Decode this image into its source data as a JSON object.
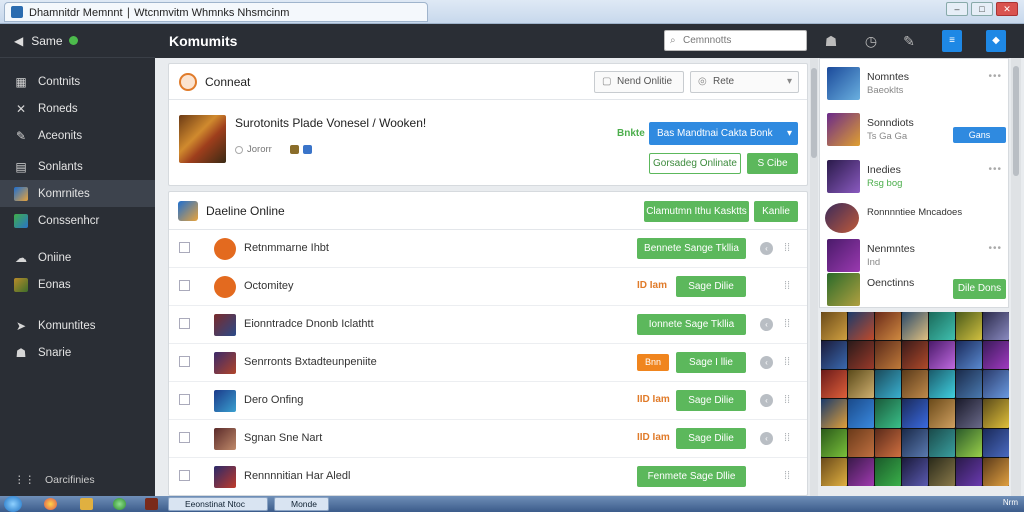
{
  "window": {
    "tab_title": "Dhamnitdr Memnnt ∣ Wtcnmvitm Whmnks Nhsmcinm",
    "minimize": "–",
    "maximize": "□",
    "close": "✕"
  },
  "sidebar": {
    "top_label": "Same",
    "items": [
      {
        "label": "Contnits",
        "icon": "chart-icon"
      },
      {
        "label": "Roneds",
        "icon": "tools-icon"
      },
      {
        "label": "Aceonits",
        "icon": "pen-icon"
      },
      {
        "label": "Sonlants",
        "icon": "book-icon"
      },
      {
        "label": "Komrnites",
        "icon": "game-icon"
      },
      {
        "label": "Conssenhcr",
        "icon": "grid-icon"
      },
      {
        "label": "Oniine",
        "icon": "cloud-icon"
      },
      {
        "label": "Eonas",
        "icon": "trophy-icon"
      },
      {
        "label": "Komuntites",
        "icon": "share-icon"
      },
      {
        "label": "Snarie",
        "icon": "users-icon"
      }
    ],
    "bottom_label": "Oarcifinies"
  },
  "header": {
    "brand": "Komumits",
    "search_placeholder": "Cemnnotts"
  },
  "connect_panel": {
    "title": "Conneat",
    "btn_friend_online": "Nend Onlitie",
    "btn_rate": "Rete",
    "featured_title": "Surotonits Plade Vonesel / Wooken!",
    "featured_meta": "Jororr",
    "featured_status": "Bnkte",
    "btn_primary": "Bas Mandtnai Cakta Bonk",
    "btn_outline": "Gorsadeg Onlinate",
    "btn_small": "S Cibe"
  },
  "online_panel": {
    "title": "Daeline Online",
    "btn_1": "Clamutmn Ithu Kasktts",
    "btn_2": "Kanlie",
    "rows": [
      {
        "name": "Retnmmarne Ihbt",
        "status": "",
        "action": "Bennete Sange Tkllia"
      },
      {
        "name": "Octomitey",
        "status": "ID Iam",
        "action": "Sage Dilie"
      },
      {
        "name": "Eionntradce Dnonb Iclathtt",
        "status": "",
        "action": "Ionnete Sage Tkllia"
      },
      {
        "name": "Senrronts Bxtadteunpeniite",
        "status": "Bnn",
        "action": "Sage I llie"
      },
      {
        "name": "Dero Onfing",
        "status": "IID Iam",
        "action": "Sage Dilie"
      },
      {
        "name": "Sgnan Sne Nart",
        "status": "IID Iam",
        "action": "Sage Dilie"
      },
      {
        "name": "Rennnnitian Har Aledl",
        "status": "",
        "action": "Fenmete Sage Dllie"
      }
    ]
  },
  "right_panel": {
    "items": [
      {
        "t1": "Nomntes",
        "t2": "Baeoklts"
      },
      {
        "t1": "Sonndiots",
        "t2": "Ts Ga Ga"
      },
      {
        "t1": "Inedies",
        "t2": "Rsg bog"
      },
      {
        "t1": "Ronnnntiee Mncadoes",
        "t2": ""
      },
      {
        "t1": "Nenmntes",
        "t2": "Ind"
      },
      {
        "t1": "Oenctinns",
        "t2": ""
      }
    ],
    "btn_view": "Gans Kancaes",
    "btn_done": "Dile Dons"
  },
  "taskbar": {
    "btn_1": "Eeonstinat Ntoc",
    "btn_2": "Monde",
    "tray": "Nrm"
  }
}
